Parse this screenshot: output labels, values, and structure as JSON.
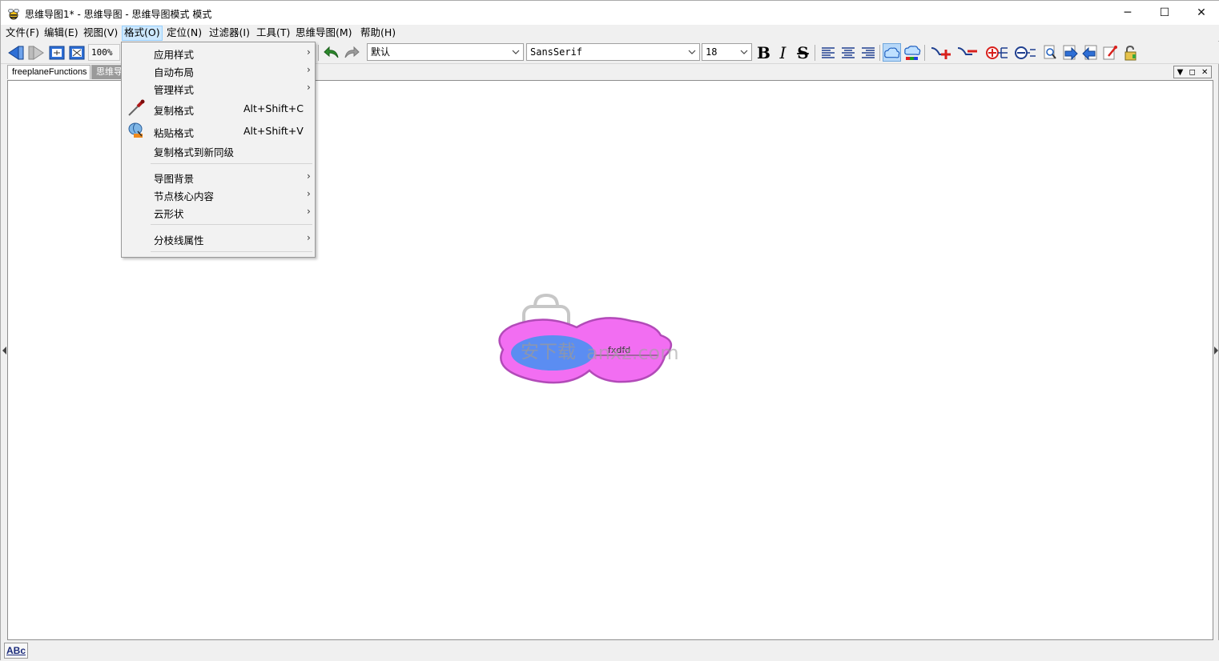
{
  "window": {
    "title": "思维导图1* - 思维导图 - 思维导图模式 模式",
    "minimize": "─",
    "maximize": "☐",
    "close": "✕"
  },
  "menubar": [
    {
      "label": "文件(F)"
    },
    {
      "label": "编辑(E)"
    },
    {
      "label": "视图(V)"
    },
    {
      "label": "格式(O)",
      "active": true
    },
    {
      "label": "定位(N)"
    },
    {
      "label": "过滤器(I)"
    },
    {
      "label": "工具(T)"
    },
    {
      "label": "思维导图(M)"
    },
    {
      "label": "帮助(H)"
    }
  ],
  "toolbar": {
    "zoom": "100%",
    "style_combo": "默认",
    "font_combo": "SansSerif",
    "size_combo": "18",
    "bold": "B",
    "italic": "I",
    "strike": "S"
  },
  "tabs": {
    "selected": "freeplaneFunctions",
    "other": "思维导"
  },
  "format_menu": {
    "items": [
      {
        "label": "应用样式",
        "submenu": true
      },
      {
        "label": "自动布局",
        "submenu": true
      },
      {
        "label": "管理样式",
        "submenu": true
      },
      {
        "label": "复制格式",
        "shortcut": "Alt+Shift+C",
        "icon": "pipette-icon"
      },
      {
        "label": "粘贴格式",
        "shortcut": "Alt+Shift+V",
        "icon": "paint-bucket-icon"
      },
      {
        "label": "复制格式到新同级"
      },
      {
        "label": "导图背景",
        "submenu": true
      },
      {
        "label": "节点核心内容",
        "submenu": true
      },
      {
        "label": "云形状",
        "submenu": true
      },
      {
        "label": "分枝线属性",
        "submenu": true
      }
    ],
    "submenu_arrow": "›"
  },
  "canvas": {
    "node_text": "fxdfd",
    "cloud_color": "#f26ef2",
    "cloud_border": "#b24ab8",
    "node_color": "#5b8df2"
  },
  "watermark": {
    "cn": "安下载",
    "en": "anxz.com"
  },
  "statusbar": {
    "spell_label": "ABc"
  },
  "colors": {
    "menu_highlight": "#cce8ff",
    "toolbar_pressed": "#b7d8f8",
    "icon_blue": "#2e6fd6",
    "icon_red": "#d8201c"
  }
}
